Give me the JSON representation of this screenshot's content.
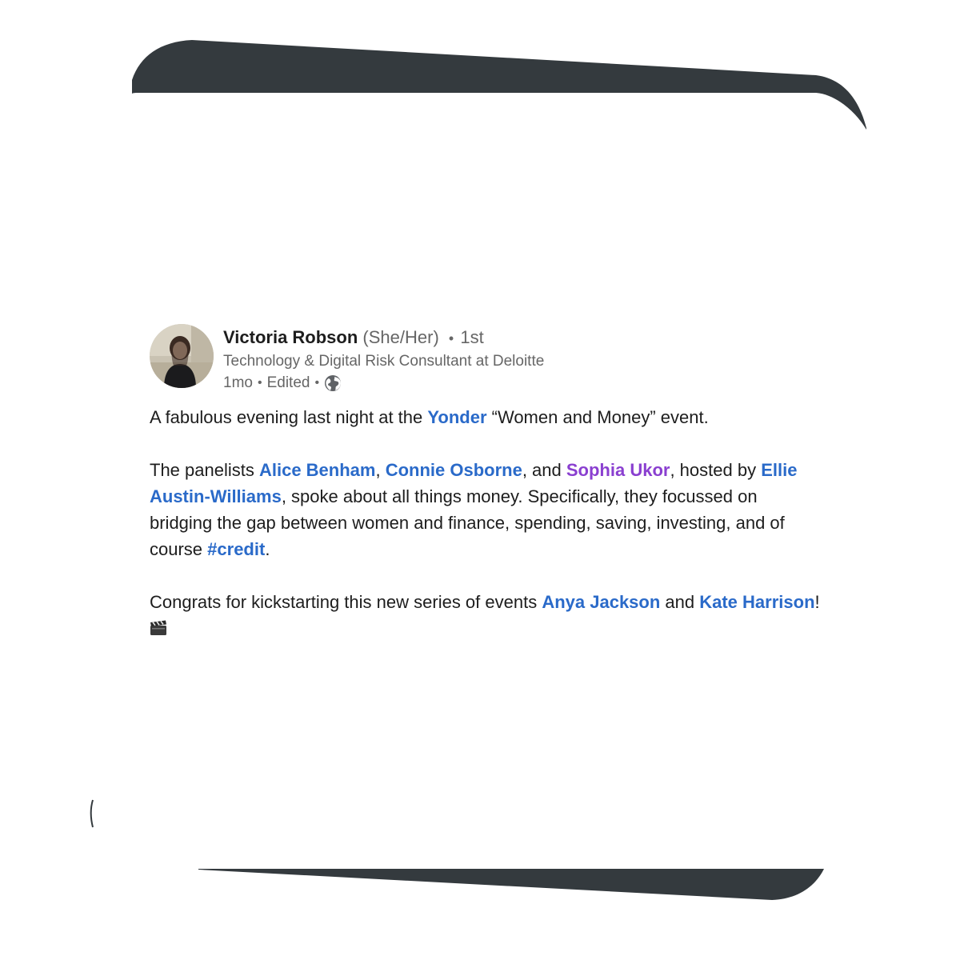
{
  "author": {
    "name": "Victoria Robson",
    "pronouns": "(She/Her)",
    "degree": "1st",
    "headline": "Technology & Digital Risk Consultant at Deloitte",
    "time": "1mo",
    "edited": "Edited",
    "visibility_icon": "globe-icon"
  },
  "post": {
    "p1": {
      "t1": "A fabulous evening last night at the ",
      "m1": "Yonder",
      "t2": " “Women and Money” event."
    },
    "p2": {
      "t1": "The panelists ",
      "m1": "Alice Benham",
      "t2": ", ",
      "m2": "Connie Osborne",
      "t3": ", and ",
      "m3": "Sophia Ukor",
      "t4": ", hosted by ",
      "m4": "Ellie Austin-Williams",
      "t5": ", spoke about all things money. Specifically, they focussed on bridging the gap between women and finance, spending, saving, investing, and of course ",
      "m5": "#credit",
      "t6": "."
    },
    "p3": {
      "t1": "Congrats for kickstarting this new series of events ",
      "m1": "Anya Jackson",
      "t2": " and ",
      "m2": "Kate Harrison",
      "t3": "! ",
      "emoji": "clapper-board-icon"
    }
  },
  "colors": {
    "mention": "#2a6ac9",
    "mention_visited": "#8a3fd0",
    "text": "#1d1d1d",
    "secondary": "#666666",
    "decoration": "#343a3e"
  }
}
